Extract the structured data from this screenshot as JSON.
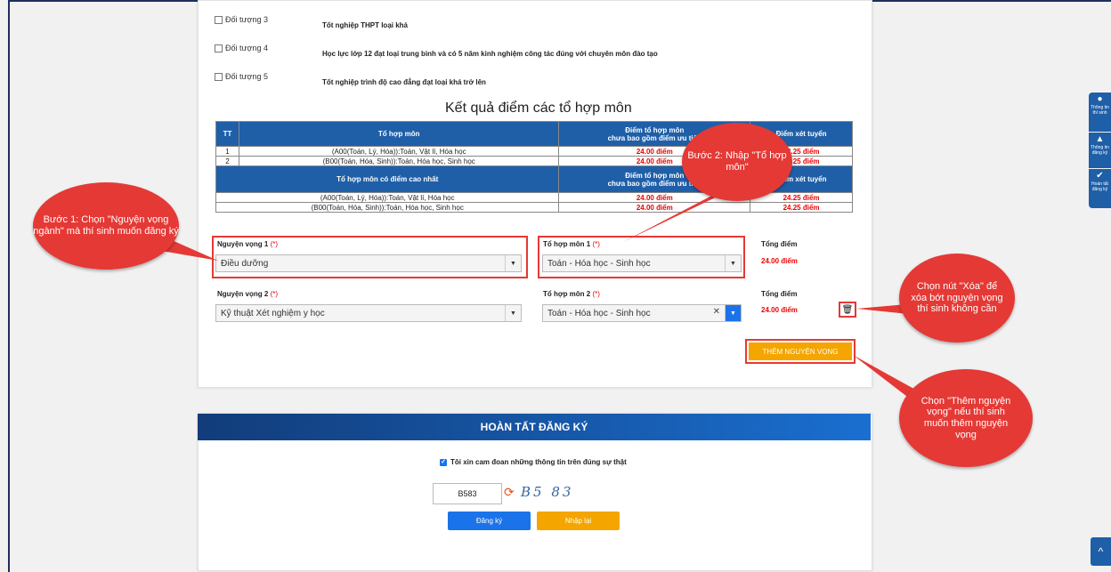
{
  "objects": [
    {
      "label": "Đối tượng 3",
      "desc": "Tốt nghiệp THPT loại khá"
    },
    {
      "label": "Đối tượng 4",
      "desc": "Học lực lớp 12 đạt loại trung bình và có 5 năm kinh nghiệm công tác đúng với chuyên môn đào tạo"
    },
    {
      "label": "Đối tượng 5",
      "desc": "Tốt nghiệp trình độ cao đẳng đạt loại khá trở lên"
    }
  ],
  "results": {
    "title": "Kết quả điểm các tổ hợp môn",
    "headers": [
      "TT",
      "Tổ hợp môn",
      "Điểm tổ hợp môn\nchưa bao gồm điểm ưu tiên",
      "Điểm xét tuyển"
    ],
    "rows": [
      {
        "tt": "1",
        "combo": "(A00(Toán, Lý, Hóa)):Toán, Vật lí, Hóa học",
        "score": "24.00 điểm",
        "admit": "24.25 điểm"
      },
      {
        "tt": "2",
        "combo": "(B00(Toán, Hóa, Sinh)):Toán, Hóa học, Sinh học",
        "score": "24.00 điểm",
        "admit": "24.25 điểm"
      }
    ],
    "best_headers": [
      "Tổ hợp môn có điểm cao nhất",
      "Điểm tổ hợp môn\nchưa bao gồm điểm ưu tiên",
      "Điểm xét tuyển"
    ],
    "best_rows": [
      {
        "combo": "(A00(Toán, Lý, Hóa)):Toán, Vật lí, Hóa học",
        "score": "24.00 điểm",
        "admit": "24.25 điểm"
      },
      {
        "combo": "(B00(Toán, Hóa, Sinh)):Toán, Hóa học, Sinh học",
        "score": "24.00 điểm",
        "admit": "24.25 điểm"
      }
    ]
  },
  "wishes": [
    {
      "label": "Nguyện vọng 1",
      "value": "Điều dưỡng",
      "combo_label": "Tổ hợp môn 1",
      "combo_value": "Toán - Hóa học - Sinh học",
      "total_label": "Tổng điểm",
      "total": "24.00 điểm"
    },
    {
      "label": "Nguyện vọng 2",
      "value": "Kỹ thuật Xét nghiệm y học",
      "combo_label": "Tổ hợp môn 2",
      "combo_value": "Toán - Hóa học - Sinh học",
      "total_label": "Tổng điểm",
      "total": "24.00 điểm"
    }
  ],
  "required_mark": "(*)",
  "add_wish_label": "THÊM NGUYỆN VỌNG",
  "callouts": {
    "step1": "Bước 1: Chọn \"Nguyện vọng ngành\" mà thí sinh muốn đăng ký",
    "step2": "Bước 2: Nhập \"Tổ hợp môn\"",
    "delete": "Chọn nút \"Xóa\" để xóa bớt nguyện vọng thí sinh không cần",
    "add": "Chọn \"Thêm nguyện vọng\" nếu thí sinh muốn thêm nguyện vọng"
  },
  "finish": {
    "header": "HOÀN TẤT ĐĂNG KÝ",
    "agree": "Tôi xin cam đoan những thông tin trên đúng sự thật",
    "captcha_value": "B583",
    "captcha_image": "B5 83",
    "register": "Đăng ký",
    "reset": "Nhập lại"
  },
  "side_tabs": [
    {
      "icon": "user-circle-icon",
      "label": "Thông tin thí sinh"
    },
    {
      "icon": "graduation-cap-icon",
      "label": "Thông tin đăng ký"
    },
    {
      "icon": "check-circle-icon",
      "label": "Hoàn tất đăng ký"
    }
  ],
  "colors": {
    "primary": "#1f5fa8",
    "accent": "#f4a500",
    "danger": "#e53935",
    "score": "#e00000"
  }
}
